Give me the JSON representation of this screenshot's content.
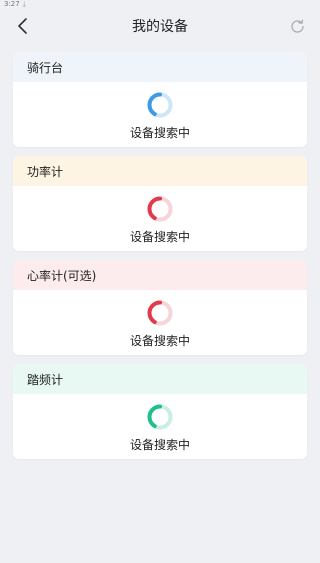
{
  "status_bar": {
    "time": "3:27"
  },
  "header": {
    "title": "我的设备"
  },
  "devices": [
    {
      "name": "骑行台",
      "status": "设备搜索中",
      "head_bg": "#eef4fa",
      "accent": "#3d9be6",
      "track": "#cde6f8"
    },
    {
      "name": "功率计",
      "status": "设备搜索中",
      "head_bg": "#fdf4e3",
      "accent": "#e03a4c",
      "track": "#f8d3d8"
    },
    {
      "name": "心率计(可选)",
      "status": "设备搜索中",
      "head_bg": "#fcecee",
      "accent": "#e03a4c",
      "track": "#f8d3d8"
    },
    {
      "name": "踏频计",
      "status": "设备搜索中",
      "head_bg": "#e8f8f3",
      "accent": "#1fbf8f",
      "track": "#c8efe1"
    }
  ]
}
